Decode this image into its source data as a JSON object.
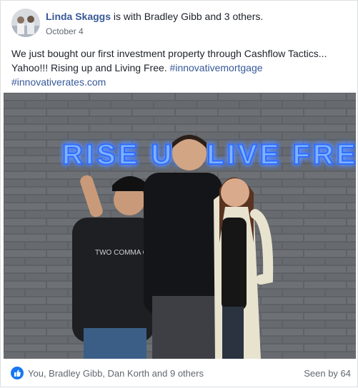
{
  "post": {
    "author": "Linda Skaggs",
    "with_text": "is with Bradley Gibb and 3 others.",
    "date": "October 4",
    "text_main": "We just bought our first investment property through Cashflow Tactics... Yahoo!!! Rising up and Living Free.",
    "hashtag_1": "#innovativemortgage",
    "hashtag_2": "#innovativerates.com"
  },
  "photo": {
    "neon_sign": "RISE UP LIVE FREE",
    "shirt_text": "TWO COMMA CLUB"
  },
  "footer": {
    "reactions_text": "You, Bradley Gibb, Dan Korth and 9 others",
    "seen_by": "Seen by 64"
  },
  "colors": {
    "link": "#385898",
    "hashtag": "#365899",
    "like_blue": "#1877f2",
    "neon_blue": "#2f6dff"
  },
  "icons": {
    "like": "thumbs-up-icon"
  }
}
